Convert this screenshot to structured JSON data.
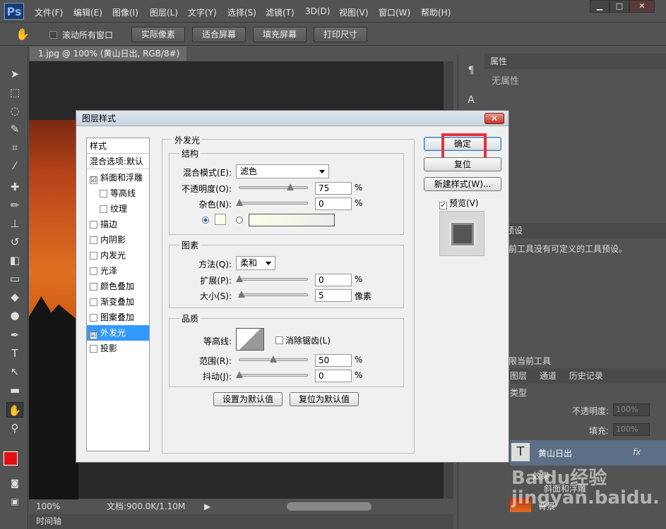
{
  "app": {
    "logo": "Ps"
  },
  "menu": [
    "文件(F)",
    "编辑(E)",
    "图像(I)",
    "图层(L)",
    "文字(Y)",
    "选择(S)",
    "滤镜(T)",
    "3D(D)",
    "视图(V)",
    "窗口(W)",
    "帮助(H)"
  ],
  "window_controls": [
    "▁",
    "□",
    "✕"
  ],
  "options_bar": {
    "scroll_all": "滚动所有窗口",
    "buttons": [
      "实际像素",
      "适合屏幕",
      "填充屏幕",
      "打印尺寸"
    ]
  },
  "document": {
    "tab": "1.jpg @ 100% (黄山日出, RGB/8#) *",
    "tab_close": "×"
  },
  "status": {
    "zoom": "100%",
    "doc_info": "文档:900.0K/1.10M"
  },
  "timeline": "时间轴",
  "right_panels": {
    "properties_tab": "属性",
    "no_properties": "无属性",
    "presets_tab": "预设",
    "presets_msg": "前工具没有可定义的工具预设。",
    "current_tool_only": "限当前工具",
    "layer_tabs": [
      "图层",
      "通道",
      "历史记录"
    ],
    "kind": "类型",
    "opacity_label": "不透明度:",
    "opacity_value": "100%",
    "fill_label": "填充:",
    "fill_value": "100%",
    "layer_name": "黄山日出",
    "fx": "fx",
    "effects": "效果",
    "bevel": "斜面和浮雕",
    "bg_layer": "背景"
  },
  "dialog": {
    "title": "图层样式",
    "close": "✕",
    "styles_header": "样式",
    "blend_default": "混合选项:默认",
    "styles": [
      {
        "label": "斜面和浮雕",
        "checked": "☑"
      },
      {
        "label": "等高线",
        "checked": ""
      },
      {
        "label": "纹理",
        "checked": ""
      },
      {
        "label": "描边",
        "checked": ""
      },
      {
        "label": "内阴影",
        "checked": ""
      },
      {
        "label": "内发光",
        "checked": ""
      },
      {
        "label": "光泽",
        "checked": ""
      },
      {
        "label": "颜色叠加",
        "checked": ""
      },
      {
        "label": "渐变叠加",
        "checked": ""
      },
      {
        "label": "图案叠加",
        "checked": ""
      },
      {
        "label": "外发光",
        "checked": "☑"
      },
      {
        "label": "投影",
        "checked": ""
      }
    ],
    "outer_glow": "外发光",
    "structure": {
      "legend": "结构",
      "blend_mode_label": "混合模式(E):",
      "blend_mode": "滤色",
      "opacity_label": "不透明度(O):",
      "opacity": "75",
      "noise_label": "杂色(N):",
      "noise": "0",
      "percent": "%"
    },
    "elements": {
      "legend": "图素",
      "method_label": "方法(Q):",
      "method": "柔和",
      "spread_label": "扩展(P):",
      "spread": "0",
      "size_label": "大小(S):",
      "size": "5",
      "px": "像素",
      "percent": "%"
    },
    "quality": {
      "legend": "品质",
      "contour_label": "等高线:",
      "antialias": "消除锯齿(L)",
      "range_label": "范围(R):",
      "range": "50",
      "jitter_label": "抖动(J):",
      "jitter": "0",
      "percent": "%"
    },
    "set_default": "设置为默认值",
    "reset_default": "复位为默认值",
    "ok": "确定",
    "reset": "复位",
    "new_style": "新建样式(W)...",
    "preview": "预览(V)"
  },
  "values": {
    "opacity_slider": 0.75,
    "noise_slider": 0.0,
    "spread_slider": 0.0,
    "size_slider": 0.03,
    "range_slider": 0.5,
    "jitter_slider": 0.0
  },
  "watermark": "Baidu经验 jingyan.baidu.com",
  "colors": {
    "highlight_box": "#e8303a",
    "selected_row": "#3399ff",
    "fg_swatch": "#e01010",
    "bg_swatch": "#ffffff"
  }
}
